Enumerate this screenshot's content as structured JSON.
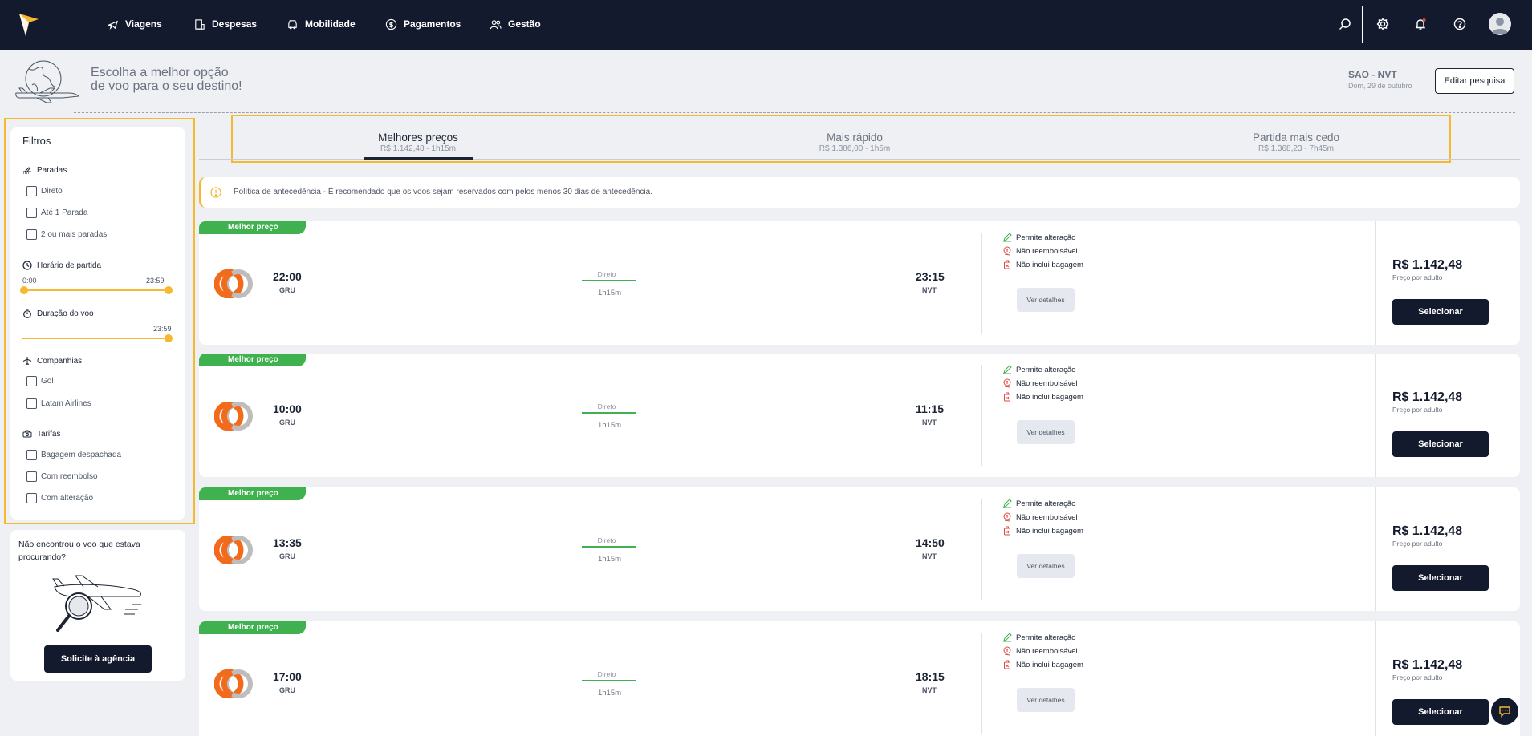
{
  "nav": {
    "items": [
      {
        "label": "Viagens",
        "icon": "airplane-icon"
      },
      {
        "label": "Despesas",
        "icon": "receipt-icon"
      },
      {
        "label": "Mobilidade",
        "icon": "car-icon"
      },
      {
        "label": "Pagamentos",
        "icon": "dollar-icon"
      },
      {
        "label": "Gestão",
        "icon": "users-icon"
      }
    ],
    "right_icons": [
      "search-icon",
      "gear-icon",
      "bell-icon",
      "help-icon",
      "avatar"
    ]
  },
  "header": {
    "line1": "Escolha a melhor opção",
    "line2": "de voo para o seu destino!",
    "route": "SAO - NVT",
    "date": "Dom, 29 de outubro",
    "edit_label": "Editar pesquisa"
  },
  "filters": {
    "title": "Filtros",
    "stops": {
      "title": "Paradas",
      "options": [
        "Direto",
        "Até 1 Parada",
        "2 ou mais paradas"
      ]
    },
    "departure": {
      "title": "Horário de partida",
      "min": "0:00",
      "max": "23:59"
    },
    "duration": {
      "title": "Duração do voo",
      "max": "23:59"
    },
    "airlines": {
      "title": "Companhias",
      "options": [
        "Gol",
        "Latam Airlines"
      ]
    },
    "fares": {
      "title": "Tarifas",
      "options": [
        "Bagagem despachada",
        "Com reembolso",
        "Com alteração"
      ]
    }
  },
  "help": {
    "text": "Não encontrou o voo que estava procurando?",
    "button": "Solicite à agência"
  },
  "tabs": [
    {
      "label": "Melhores preços",
      "sub": "R$ 1.142,48 - 1h15m",
      "active": true
    },
    {
      "label": "Mais rápido",
      "sub": "R$ 1.386,00 - 1h5m",
      "active": false
    },
    {
      "label": "Partida mais cedo",
      "sub": "R$ 1.368,23 - 7h45m",
      "active": false
    }
  ],
  "policy": {
    "text": "Política de antecedência - É recomendado que os voos sejam reservados com pelos menos 30 dias de antecedência."
  },
  "flights": [
    {
      "badge": "Melhor preço",
      "dep_time": "22:00",
      "dep_code": "GRU",
      "stops": "Direto",
      "duration": "1h15m",
      "arr_time": "23:15",
      "arr_code": "NVT",
      "cond1": "Permite alteração",
      "cond2": "Não reembolsável",
      "cond3": "Não inclui bagagem",
      "details": "Ver detalhes",
      "price": "R$ 1.142,48",
      "price_sub": "Preço por adulto",
      "select": "Selecionar"
    },
    {
      "badge": "Melhor preço",
      "dep_time": "10:00",
      "dep_code": "GRU",
      "stops": "Direto",
      "duration": "1h15m",
      "arr_time": "11:15",
      "arr_code": "NVT",
      "cond1": "Permite alteração",
      "cond2": "Não reembolsável",
      "cond3": "Não inclui bagagem",
      "details": "Ver detalhes",
      "price": "R$ 1.142,48",
      "price_sub": "Preço por adulto",
      "select": "Selecionar"
    },
    {
      "badge": "Melhor preço",
      "dep_time": "13:35",
      "dep_code": "GRU",
      "stops": "Direto",
      "duration": "1h15m",
      "arr_time": "14:50",
      "arr_code": "NVT",
      "cond1": "Permite alteração",
      "cond2": "Não reembolsável",
      "cond3": "Não inclui bagagem",
      "details": "Ver detalhes",
      "price": "R$ 1.142,48",
      "price_sub": "Preço por adulto",
      "select": "Selecionar"
    },
    {
      "badge": "Melhor preço",
      "dep_time": "17:00",
      "dep_code": "GRU",
      "stops": "Direto",
      "duration": "1h15m",
      "arr_time": "18:15",
      "arr_code": "NVT",
      "cond1": "Permite alteração",
      "cond2": "Não reembolsável",
      "cond3": "Não inclui bagagem",
      "details": "Ver detalhes",
      "price": "R$ 1.142,48",
      "price_sub": "Preço por adulto",
      "select": "Selecionar"
    }
  ],
  "colors": {
    "navy": "#141a2e",
    "accent": "#f5b82e",
    "green": "#3fb24f",
    "orange": "#f26b1d",
    "red": "#e0483e"
  }
}
